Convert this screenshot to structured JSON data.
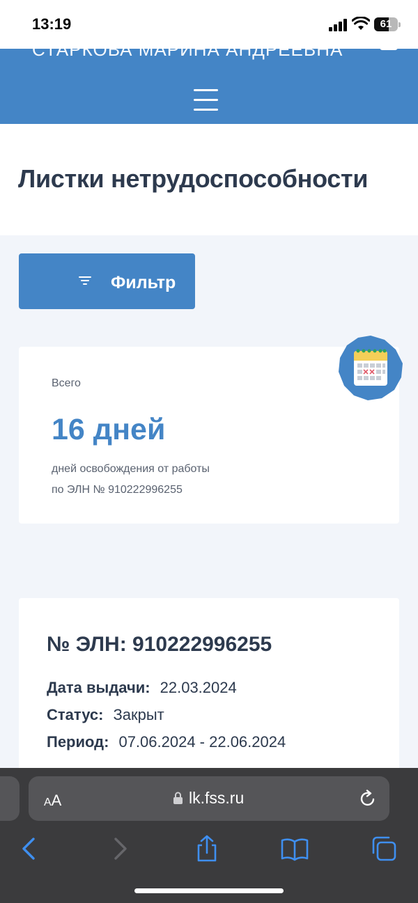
{
  "status_bar": {
    "time": "13:19",
    "battery_level": "61"
  },
  "header": {
    "user_name": "СТАРКОВА МАРИНА АНДРЕЕВНА"
  },
  "page": {
    "title": "Листки нетрудоспособности"
  },
  "filter": {
    "label": "Фильтр"
  },
  "summary": {
    "label": "Всего",
    "value": "16 дней",
    "description_line1": "дней освобождения от работы",
    "description_line2": "по ЭЛН № 910222996255"
  },
  "eln_card": {
    "title": "№ ЭЛН: 910222996255",
    "rows": [
      {
        "label": "Дата выдачи:",
        "value": "22.03.2024"
      },
      {
        "label": "Статус:",
        "value": "Закрыт"
      },
      {
        "label": "Период:",
        "value": "07.06.2024 - 22.06.2024"
      }
    ]
  },
  "browser": {
    "text_size_small": "A",
    "text_size_big": "A",
    "url": "lk.fss.ru"
  },
  "colors": {
    "accent": "#4485c6",
    "text_dark": "#2d3a4e",
    "page_bg": "#f2f5fa",
    "safari_bar": "#3b3b3d"
  }
}
